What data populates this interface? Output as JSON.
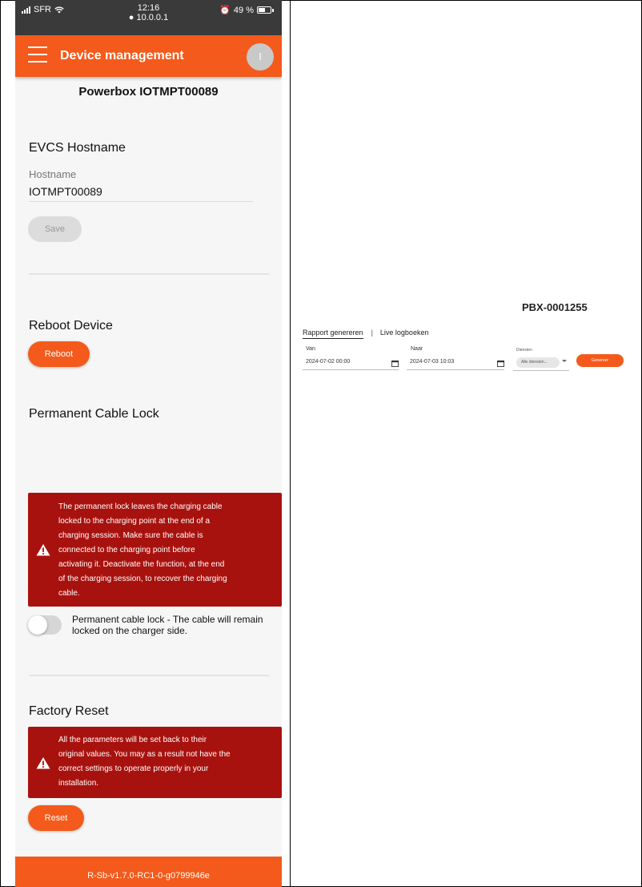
{
  "status_bar": {
    "carrier": "SFR",
    "time": "12:16",
    "address": "10.0.0.1",
    "battery": "49 %"
  },
  "app_bar": {
    "title": "Device management",
    "avatar_initial": "I"
  },
  "device": {
    "title": "Powerbox IOTMPT00089"
  },
  "hostname_section": {
    "title": "EVCS Hostname",
    "field_label": "Hostname",
    "field_value": "IOTMPT00089",
    "save_label": "Save"
  },
  "reboot_section": {
    "title": "Reboot Device",
    "button_label": "Reboot"
  },
  "cable_lock_section": {
    "title": "Permanent Cable Lock",
    "warning_lines": [
      "The permanent lock leaves the charging cable",
      "locked to the charging point at the end of a",
      "charging session. Make sure the cable is",
      "connected to the charging point before",
      "activating it.  Deactivate the function, at the end",
      "of the charging session, to recover the charging",
      "cable."
    ],
    "toggle_label": "Permanent cable lock - The cable will remain locked on the charger side.",
    "toggle_on": false
  },
  "factory_reset_section": {
    "title": "Factory Reset",
    "warning_lines": [
      "All the parameters will be set back to their",
      "original values. You may as a result not have the",
      "correct settings to operate properly in your",
      "installation."
    ],
    "button_label": "Reset"
  },
  "footer": {
    "version": "R-Sb-v1.7.0-RC1-0-g0799946e"
  },
  "report_panel": {
    "title": "PBX-0001255",
    "tabs": [
      "Rapport genereren",
      "Live logboeken"
    ],
    "tab_separator": "|",
    "from_label": "Van",
    "from_value": "2024-07-02 00:00",
    "to_label": "Naar",
    "to_value": "2024-07-03 10:03",
    "services_label": "Diensten",
    "services_value": "Alle diensten...",
    "generate_label": "Genereer"
  },
  "colors": {
    "accent": "#f45a1b",
    "warning": "#a8120e",
    "status_bar": "#3a3a3a"
  }
}
